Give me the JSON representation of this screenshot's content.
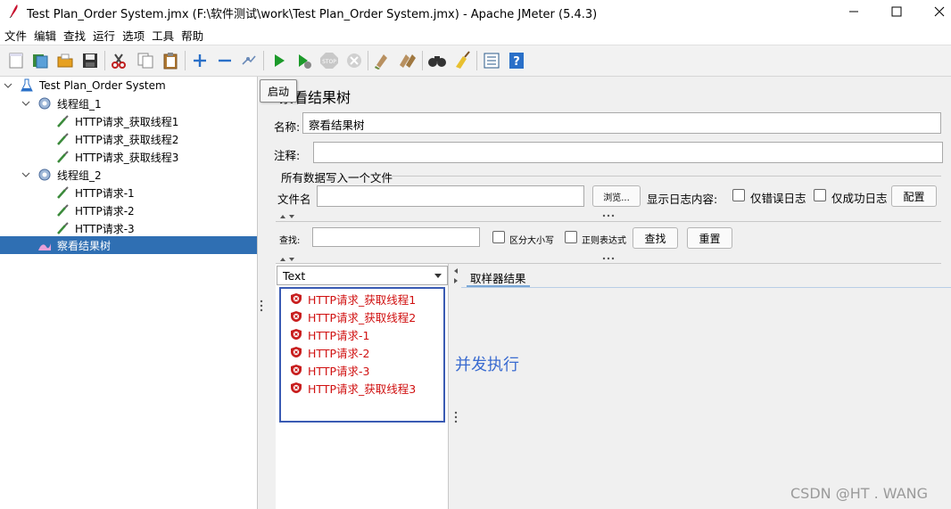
{
  "window": {
    "title": "Test Plan_Order System.jmx (F:\\软件测试\\work\\Test Plan_Order System.jmx) - Apache JMeter (5.4.3)",
    "minimize": "—",
    "maximize": "☐",
    "close": "✕"
  },
  "menu": [
    "文件",
    "编辑",
    "查找",
    "运行",
    "选项",
    "工具",
    "帮助"
  ],
  "tooltip": "启动",
  "tree": {
    "root": "Test Plan_Order System",
    "group1": "线程组_1",
    "g1_items": [
      "HTTP请求_获取线程1",
      "HTTP请求_获取线程2",
      "HTTP请求_获取线程3"
    ],
    "group2": "线程组_2",
    "g2_items": [
      "HTTP请求-1",
      "HTTP请求-2",
      "HTTP请求-3"
    ],
    "listener": "察看结果树"
  },
  "panel": {
    "title": "察看结果树",
    "name_label": "名称:",
    "name_value": "察看结果树",
    "comment_label": "注释:",
    "comment_value": "",
    "file_group": "所有数据写入一个文件",
    "filename_label": "文件名",
    "filename_value": "",
    "browse": "浏览...",
    "log_label": "显示日志内容:",
    "errors_only": "仅错误日志",
    "success_only": "仅成功日志",
    "configure": "配置",
    "search_label": "查找:",
    "case_sensitive": "区分大小写",
    "regex": "正则表达式",
    "find_btn": "查找",
    "reset_btn": "重置",
    "renderer": "Text",
    "result_tab": "取样器结果"
  },
  "results": [
    "HTTP请求_获取线程1",
    "HTTP请求_获取线程2",
    "HTTP请求-1",
    "HTTP请求-2",
    "HTTP请求-3",
    "HTTP请求_获取线程3"
  ],
  "annotation": "并发执行",
  "watermark": "CSDN @HT . WANG",
  "colors": {
    "selection": "#2f6fb3",
    "error_text": "#d01010",
    "annotation": "#3a6bd0",
    "box_border": "#3a5bb3"
  }
}
